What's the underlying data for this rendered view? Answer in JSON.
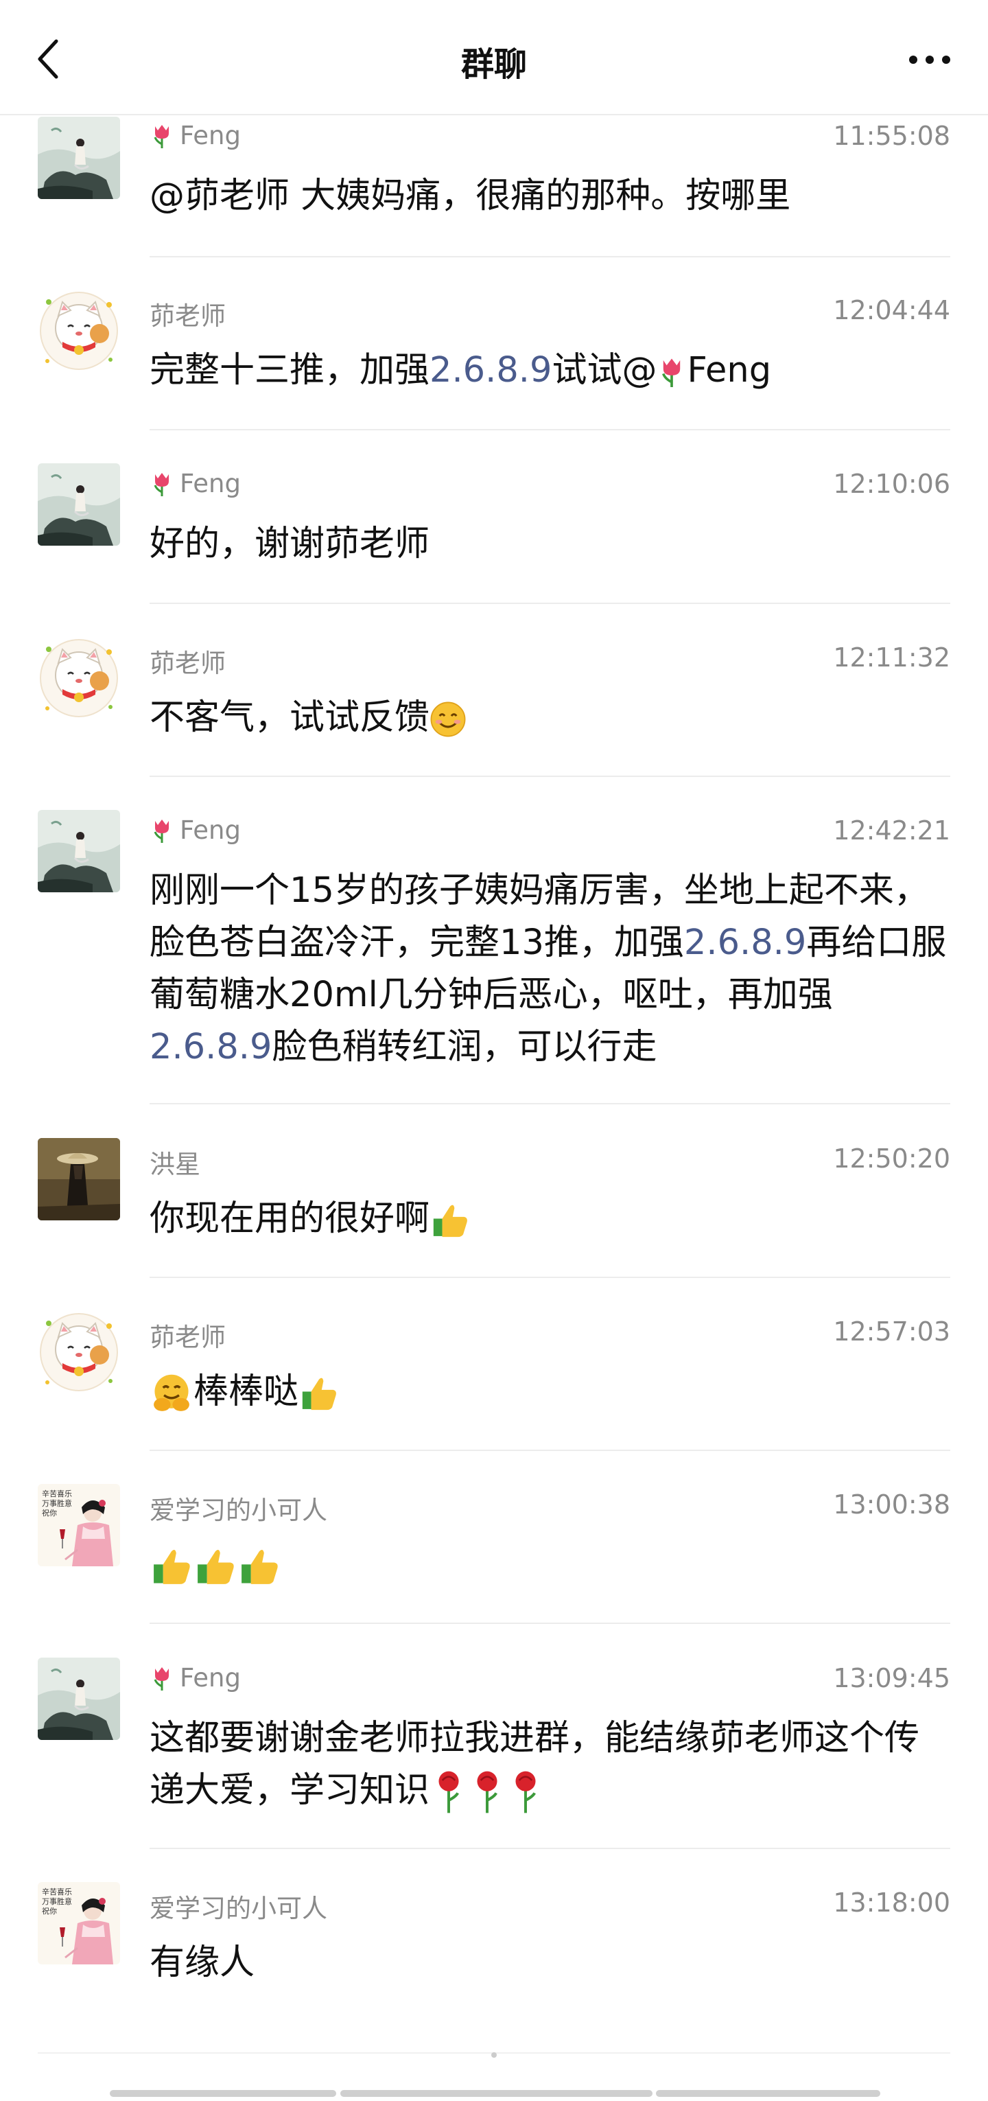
{
  "header": {
    "title": "群聊",
    "back_icon": "chevron-left-icon",
    "more_icon": "more-dots-icon"
  },
  "colors": {
    "link": "#4a5b8c",
    "meta": "#8a8a8a",
    "separator": "#ececec"
  },
  "messages": [
    {
      "avatar": "landscape-woman-avatar",
      "sender": "Feng",
      "sender_flower": true,
      "time": "11:55:08",
      "parts": [
        "@茆老师 大姨妈痛，很痛的那种。按哪里"
      ]
    },
    {
      "avatar": "lucky-cat-avatar",
      "sender": "茆老师",
      "sender_flower": false,
      "time": "12:04:44",
      "parts": [
        "完整十三推，加强",
        "2.6.8.9",
        "试试@",
        "Feng"
      ]
    },
    {
      "avatar": "landscape-woman-avatar",
      "sender": "Feng",
      "sender_flower": true,
      "time": "12:10:06",
      "parts": [
        "好的，谢谢茆老师"
      ]
    },
    {
      "avatar": "lucky-cat-avatar",
      "sender": "茆老师",
      "sender_flower": false,
      "time": "12:11:32",
      "parts": [
        "不客气，试试反馈"
      ]
    },
    {
      "avatar": "landscape-woman-avatar",
      "sender": "Feng",
      "sender_flower": true,
      "time": "12:42:21",
      "parts": [
        "刚刚一个15岁的孩子姨妈痛厉害，坐地上起不来，脸色苍白盗冷汗，完整13推，加强",
        "2.6.8.9",
        "再给口服葡萄糖水20ml几分钟后恶心，呕吐，再加强",
        "2.6.8.9",
        "脸色稍转红润，可以行走"
      ]
    },
    {
      "avatar": "straw-hat-avatar",
      "sender": "洪星",
      "sender_flower": false,
      "time": "12:50:20",
      "parts": [
        "你现在用的很好啊"
      ]
    },
    {
      "avatar": "lucky-cat-avatar",
      "sender": "茆老师",
      "sender_flower": false,
      "time": "12:57:03",
      "parts": [
        "棒棒哒"
      ]
    },
    {
      "avatar": "painted-lady-avatar",
      "sender": "爱学习的小可人",
      "sender_flower": false,
      "time": "13:00:38",
      "parts": [
        ""
      ]
    },
    {
      "avatar": "landscape-woman-avatar",
      "sender": "Feng",
      "sender_flower": true,
      "time": "13:09:45",
      "parts": [
        "这都要谢谢金老师拉我进群，能结缘茆老师这个传递大爱，学习知识"
      ]
    },
    {
      "avatar": "painted-lady-avatar",
      "sender": "爱学习的小可人",
      "sender_flower": false,
      "time": "13:18:00",
      "parts": [
        "有缘人"
      ]
    }
  ]
}
